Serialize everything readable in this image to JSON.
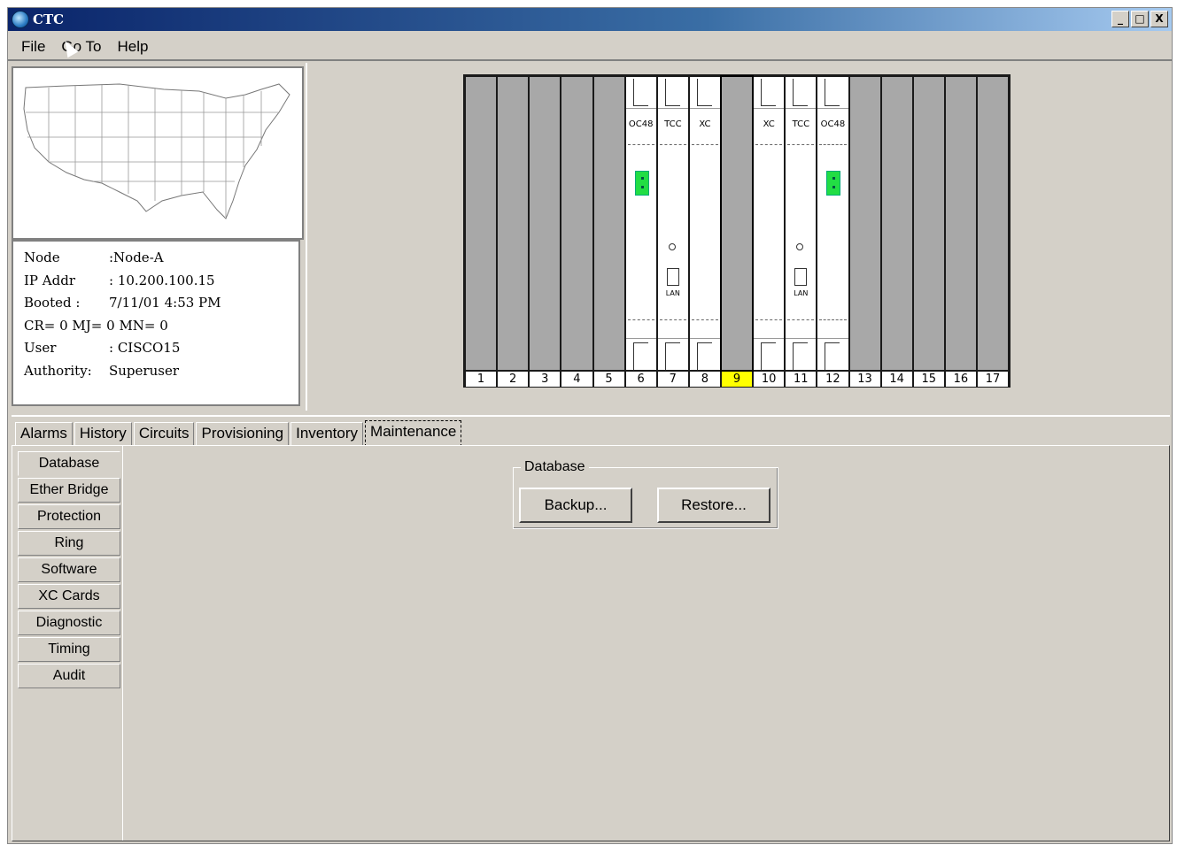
{
  "window": {
    "title": "CTC",
    "buttons": [
      "_",
      "□",
      "X"
    ]
  },
  "menu": {
    "items": [
      "File",
      "Go To",
      "Help"
    ]
  },
  "node_info": {
    "rows": [
      {
        "label": "Node",
        "value": ":Node-A"
      },
      {
        "label": "IP Addr",
        "value": ": 10.200.100.15"
      },
      {
        "label": "Booted :",
        "value": "7/11/01 4:53 PM"
      },
      {
        "label": "CR= 0 MJ= 0 MN= 0",
        "value": ""
      },
      {
        "label": "User",
        "value": ": CISCO15"
      },
      {
        "label": "Authority:",
        "value": "Superuser"
      }
    ]
  },
  "shelf": {
    "slot_numbers": [
      "1",
      "2",
      "3",
      "4",
      "5",
      "6",
      "7",
      "8",
      "9",
      "10",
      "11",
      "12",
      "13",
      "14",
      "15",
      "16",
      "17"
    ],
    "selected_slot": "9",
    "card_labels": {
      "6": "OC48",
      "7": "TCC",
      "8": "XC",
      "10": "XC",
      "11": "TCC",
      "12": "OC48"
    },
    "lan_label": "LAN"
  },
  "tabs": [
    "Alarms",
    "History",
    "Circuits",
    "Provisioning",
    "Inventory",
    "Maintenance"
  ],
  "active_tab": "Maintenance",
  "subtabs": [
    "Database",
    "Ether Bridge",
    "Protection",
    "Ring",
    "Software",
    "XC Cards",
    "Diagnostic",
    "Timing",
    "Audit"
  ],
  "active_subtab": "Database",
  "database_group": {
    "title": "Database",
    "backup_label": "Backup...",
    "restore_label": "Restore..."
  },
  "colors": {
    "led_active": "#22dd44",
    "slot_selected": "#ffff00",
    "title_bar": "#0a246a"
  }
}
